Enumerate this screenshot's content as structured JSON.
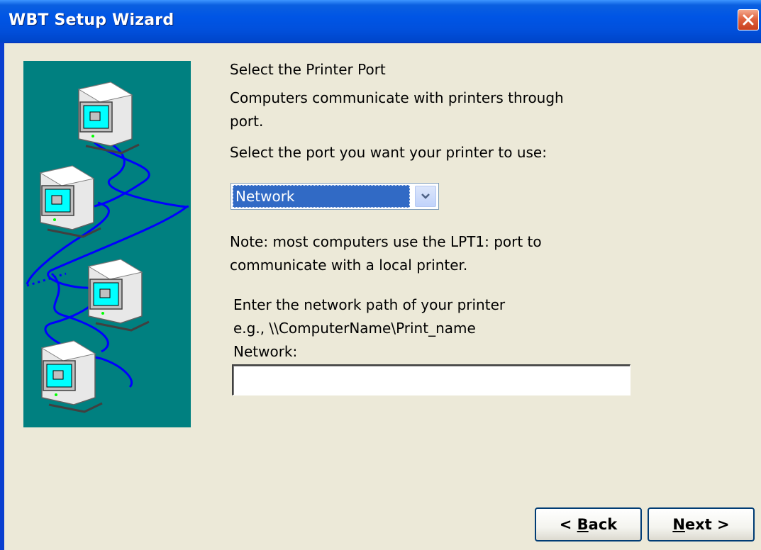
{
  "window": {
    "title": "WBT Setup Wizard",
    "close_icon": "close-icon"
  },
  "content": {
    "heading": "Select the Printer Port",
    "description_line1": "Computers communicate with printers through",
    "description_line2": "port.",
    "select_prompt": "Select the port you want your printer to use:",
    "port_select": {
      "value": "Network"
    },
    "note_line1": "Note: most computers use the LPT1: port to",
    "note_line2": "communicate with a local printer.",
    "network_path_line1": "Enter the network path of your printer",
    "network_path_line2": "e.g., \\\\ComputerName\\Print_name",
    "network_label": "Network:",
    "network_input": {
      "value": ""
    }
  },
  "buttons": {
    "back_prefix": "< ",
    "back_mnemonic": "B",
    "back_rest": "ack",
    "next_mnemonic": "N",
    "next_rest": "ext >"
  },
  "colors": {
    "titlebar": "#0055e5",
    "illustration_bg": "#008080",
    "network_lines": "#0000ff",
    "selection": "#316ac5"
  }
}
